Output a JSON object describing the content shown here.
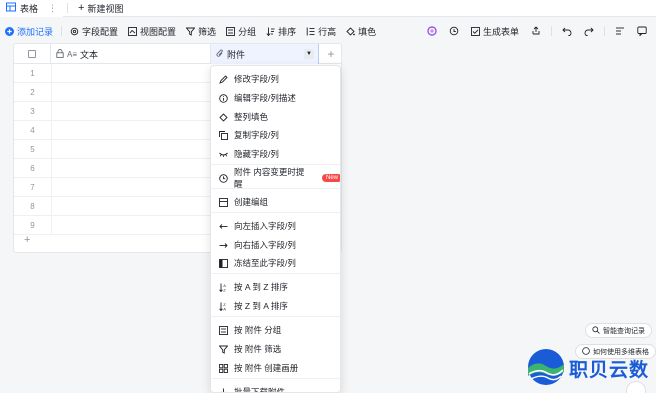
{
  "tabs": [
    {
      "label": "表格",
      "icon": "table-icon",
      "active": true
    },
    {
      "label": "新建视图",
      "icon": "plus-icon"
    }
  ],
  "toolbar": {
    "add_record": "添加记录",
    "field_config": "字段配置",
    "view_config": "视图配置",
    "filter": "筛选",
    "group": "分组",
    "sort": "排序",
    "row_height": "行高",
    "fill_color": "填色",
    "generate_form": "生成表单"
  },
  "grid": {
    "columns": [
      {
        "label": "文本",
        "icon": "text-field-icon"
      },
      {
        "label": "附件",
        "icon": "paperclip-icon"
      }
    ],
    "row_numbers": [
      "1",
      "2",
      "3",
      "4",
      "5",
      "6",
      "7",
      "8",
      "9"
    ]
  },
  "menu": {
    "items": [
      {
        "label": "修改字段/列",
        "icon": "edit-icon"
      },
      {
        "label": "编辑字段/列描述",
        "icon": "info-icon"
      },
      {
        "label": "整列填色",
        "icon": "paint-bucket-icon"
      },
      {
        "label": "复制字段/列",
        "icon": "copy-icon"
      },
      {
        "label": "隐藏字段/列",
        "icon": "eye-hidden-icon"
      },
      {
        "label": "附件 内容变更时提醒",
        "icon": "clock-icon",
        "badge": "New"
      },
      {
        "label": "创建编组",
        "icon": "group-create-icon"
      },
      {
        "label": "向左插入字段/列",
        "icon": "arrow-left-icon"
      },
      {
        "label": "向右插入字段/列",
        "icon": "arrow-right-icon"
      },
      {
        "label": "冻结至此字段/列",
        "icon": "freeze-icon"
      },
      {
        "label": "按 A 到 Z 排序",
        "icon": "sort-asc-icon"
      },
      {
        "label": "按 Z 到 A 排序",
        "icon": "sort-desc-icon"
      },
      {
        "label": "按 附件 分组",
        "icon": "group-icon"
      },
      {
        "label": "按 附件 筛选",
        "icon": "filter-icon"
      },
      {
        "label": "按 附件 创建画册",
        "icon": "gallery-icon"
      },
      {
        "label": "批量下载附件",
        "icon": "download-icon"
      }
    ]
  },
  "side": {
    "smart_query": "智能查询记录",
    "how_to_use": "如何使用多维表格"
  },
  "logo": {
    "text": "职贝云数"
  },
  "colors": {
    "accent": "#1e6fff",
    "badge": "#f54a45",
    "logo_blue": "#1a5cd8",
    "logo_green": "#3cb371"
  }
}
